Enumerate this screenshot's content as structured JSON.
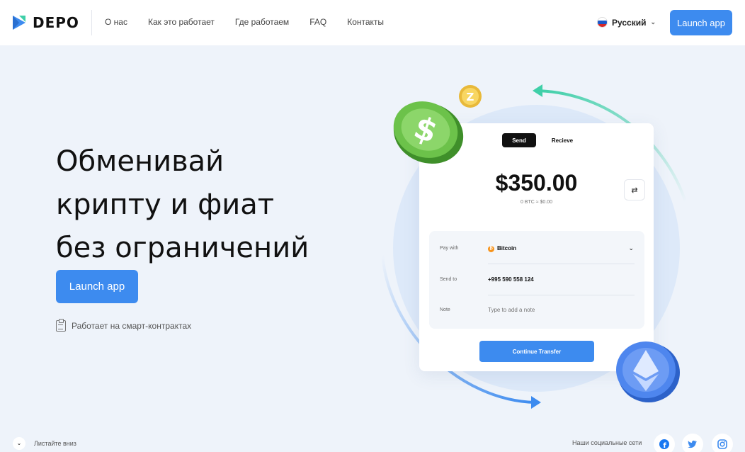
{
  "header": {
    "logo_text": "DEPO",
    "nav": [
      "О нас",
      "Как это работает",
      "Где работаем",
      "FAQ",
      "Контакты"
    ],
    "language": "Русский",
    "launch_label": "Launch app"
  },
  "hero": {
    "title_lines": [
      "Обменивай",
      "крипту и фиат",
      "без ограничений"
    ],
    "launch_label": "Launch app",
    "smart_contracts": "Работает на смарт-контрактах"
  },
  "card": {
    "tab_send": "Send",
    "tab_receive": "Recieve",
    "amount": "$350.00",
    "conversion": "0 BTC ≈ $0.00",
    "rows": {
      "pay_with_label": "Pay with",
      "pay_with_value": "Bitcoin",
      "send_to_label": "Send to",
      "send_to_value": "+995 590 558 124",
      "note_label": "Note",
      "note_placeholder": "Type to add a note"
    },
    "continue_label": "Continue Transfer"
  },
  "footer": {
    "scroll_hint": "Листайте вниз",
    "social_label": "Наши социальные сети",
    "social_icons": [
      "facebook-icon",
      "twitter-icon",
      "instagram-icon"
    ]
  },
  "colors": {
    "accent": "#3d8bef",
    "background": "#eef3fa",
    "green_coin": "#6cc24a",
    "eth_coin": "#4e86ee"
  }
}
